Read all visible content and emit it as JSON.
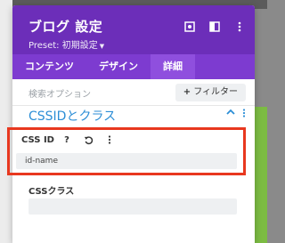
{
  "panel": {
    "title": "ブログ 設定",
    "preset": "Preset: 初期設定",
    "header_icons": [
      "target-icon",
      "columns-icon",
      "more-vertical-icon"
    ]
  },
  "tabs": [
    {
      "label": "コンテンツ",
      "active": false
    },
    {
      "label": "デザイン",
      "active": false
    },
    {
      "label": "詳細",
      "active": true
    }
  ],
  "toolbar": {
    "search_placeholder": "検索オプション",
    "filter_label": "フィルター"
  },
  "section": {
    "title": "CSSIDとクラス"
  },
  "fields": {
    "css_id": {
      "label": "CSS ID",
      "value": "id-name"
    },
    "css_class": {
      "label": "CSSクラス",
      "value": ""
    }
  },
  "colors": {
    "header": "#6c2eb9",
    "tabs": "#7d3bd0",
    "active_tab": "#8f4fde",
    "accent_blue": "#2c8ed6",
    "highlight_red": "#e8381f"
  }
}
